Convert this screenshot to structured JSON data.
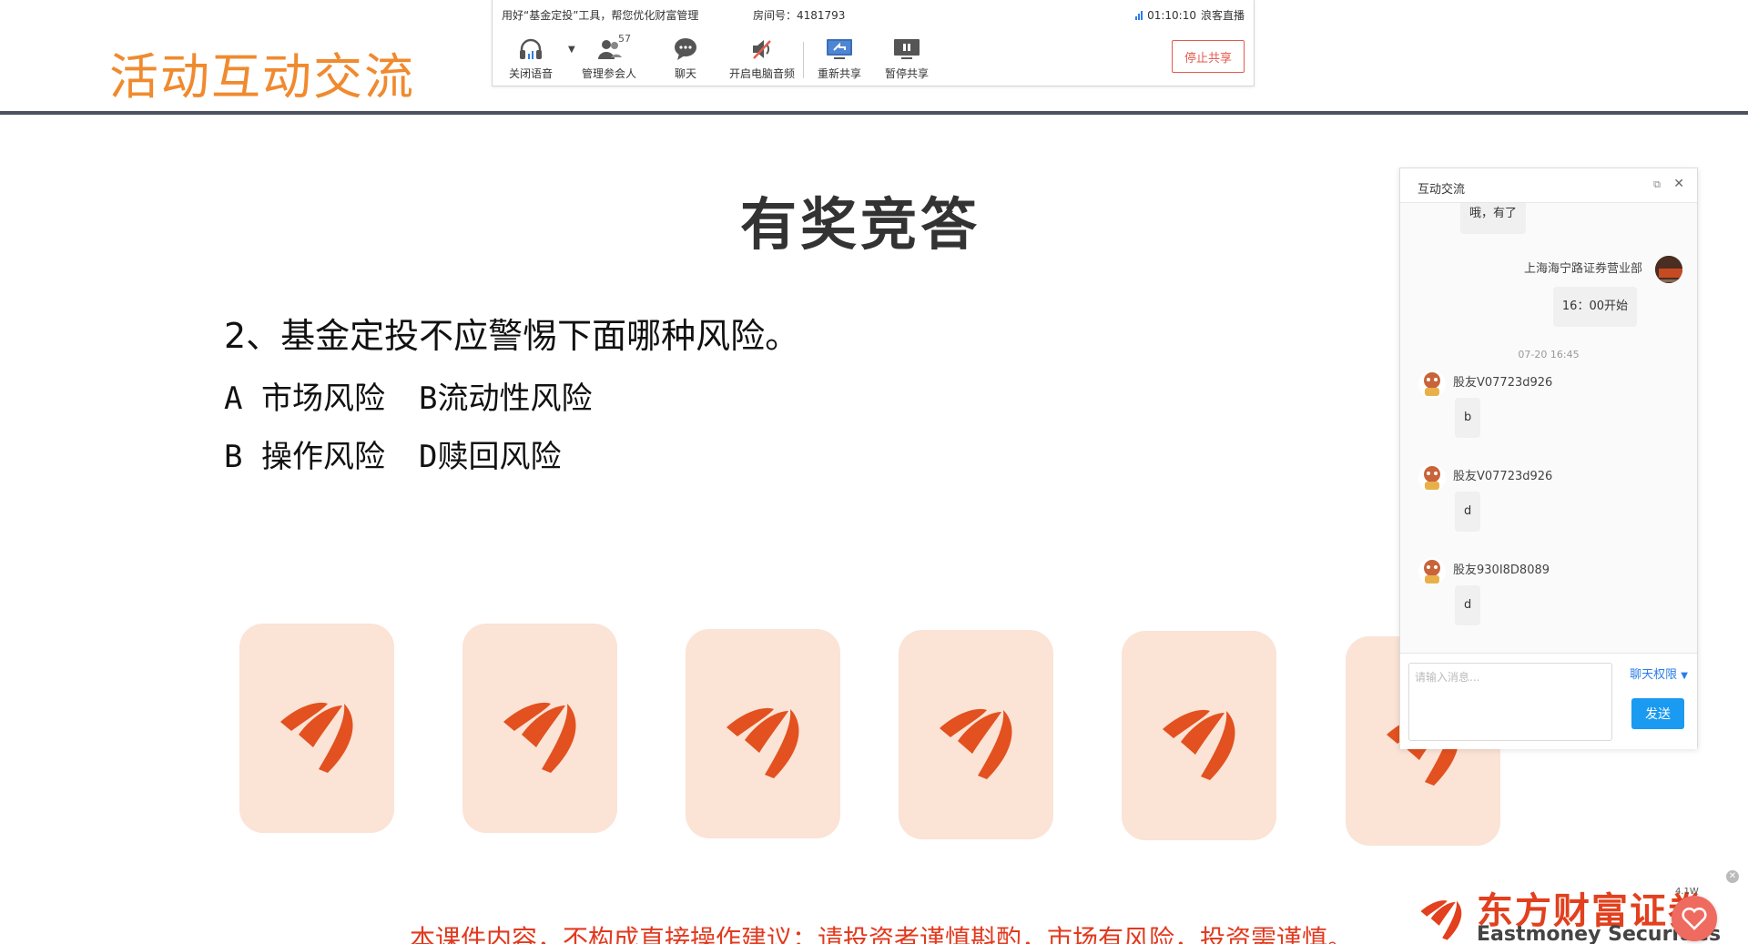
{
  "slide": {
    "header_title": "活动互动交流",
    "quiz_title": "有奖竞答",
    "question": "2、基金定投不应警惕下面哪种风险。",
    "options": [
      {
        "left": "A 市场风险",
        "right": "B流动性风险"
      },
      {
        "left": "B 操作风险",
        "right": "D赎回风险"
      }
    ],
    "disclaimer": "本课件内容，不构成直接操作建议；请投资者谨慎斟酌，市场有风险，投资需谨慎。"
  },
  "toolbar": {
    "promo_text": "用好“基金定投”工具，帮您优化财富管理",
    "room_label": "房间号：4181793",
    "timer": "01:10:10",
    "live_label": "浪客直播",
    "items": [
      {
        "label": "关闭语音",
        "icon": "headset-icon"
      },
      {
        "label": "管理参会人",
        "icon": "participants-icon",
        "badge": "57"
      },
      {
        "label": "聊天",
        "icon": "chat-bubble-icon"
      },
      {
        "label": "开启电脑音频",
        "icon": "speaker-muted-icon"
      },
      {
        "label": "重新共享",
        "icon": "screen-share-icon"
      },
      {
        "label": "暂停共享",
        "icon": "pause-share-icon"
      }
    ],
    "stop_share_label": "停止共享",
    "accent_color": "#e35b4f"
  },
  "chat": {
    "title": "互动交流",
    "messages": [
      {
        "sender": "",
        "text": "哦，有了",
        "side": "left"
      },
      {
        "sender": "上海海宁路证券营业部",
        "text": "16：00开始",
        "side": "right"
      },
      {
        "timestamp": "07-20 16:45"
      },
      {
        "sender": "股友V07723d926",
        "text": "b",
        "side": "left"
      },
      {
        "sender": "股友V07723d926",
        "text": "d",
        "side": "left"
      },
      {
        "sender": "股友930I8D8089",
        "text": "d",
        "side": "left"
      }
    ],
    "input_placeholder": "请输入消息...",
    "permission_label": "聊天权限",
    "send_label": "发送"
  },
  "brand": {
    "name_cn": "东方财富证券",
    "name_en": "Eastmoney Securities",
    "version": "4.1W",
    "color": "#e2401e"
  },
  "cards": {
    "count": 6,
    "color": "#fbe3d6",
    "icon": "eastmoney-logo-icon"
  }
}
